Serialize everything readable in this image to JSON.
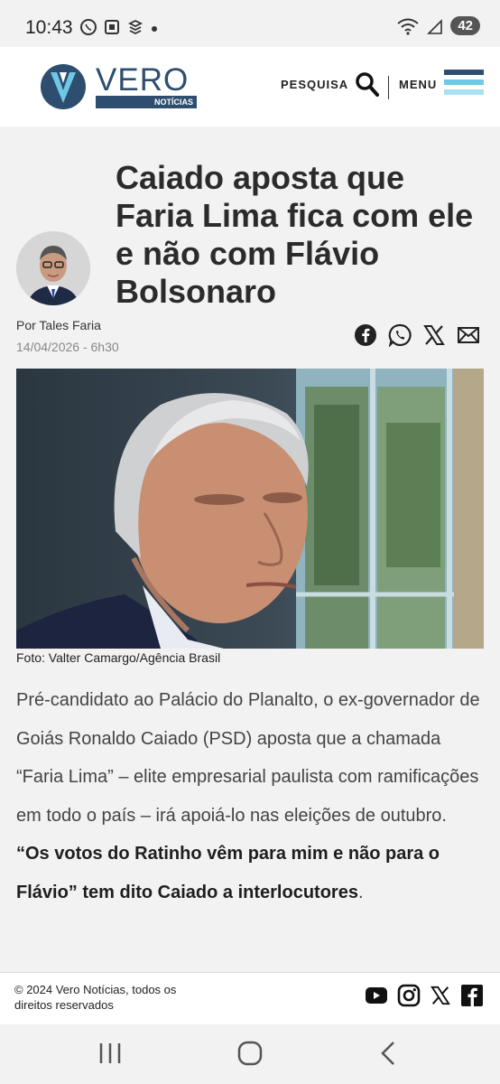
{
  "status": {
    "time": "10:43",
    "battery": "42"
  },
  "header": {
    "logo_word": "VERO",
    "logo_sub": "NOTÍCIAS",
    "search_label": "PESQUISA",
    "menu_label": "MENU",
    "menu_colors": [
      "#2d4e6e",
      "#6ec8e6",
      "#a9e1f2"
    ]
  },
  "article": {
    "headline": "Caiado aposta que Faria Lima fica com ele e não com Flávio Bolsonaro",
    "byline": "Por Tales Faria",
    "date": "14/04/2026 - 6h30",
    "photo_caption": "Foto: Valter Camargo/Agência Brasil",
    "body_regular": "Pré-candidato ao Palácio do Planalto, o ex-governador de Goiás Ronaldo Caiado (PSD) aposta que a chamada “Faria Lima” – elite empresarial paulista com ramificações em todo o país – irá apoiá-lo nas eleições de outubro. ",
    "body_bold": "“Os votos do Ratinho vêm para mim e não para o Flávio” tem dito Caiado a interlocutores",
    "body_end": "."
  },
  "share_icons": [
    "facebook-icon",
    "whatsapp-icon",
    "x-icon",
    "email-icon"
  ],
  "footer": {
    "copyright": "© 2024 Vero Notícias, todos os direitos reservados",
    "social_icons": [
      "youtube-icon",
      "instagram-icon",
      "x-icon",
      "facebook-icon"
    ]
  },
  "colors": {
    "brand": "#2d4e6e",
    "accent_light": "#6ec8e6"
  }
}
